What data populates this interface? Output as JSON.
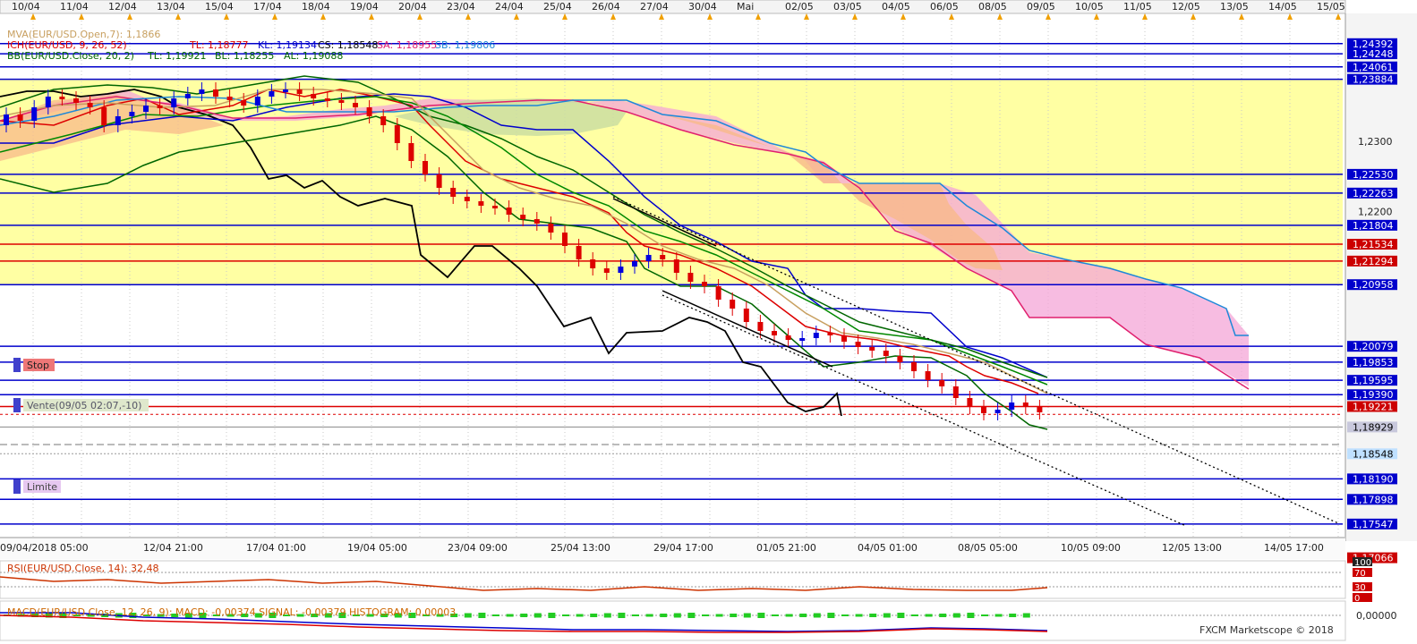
{
  "chart_data": {
    "type": "candlestick",
    "symbol": "EUR/USD",
    "top_dates": [
      "10/04",
      "11/04",
      "12/04",
      "13/04",
      "15/04",
      "17/04",
      "18/04",
      "19/04",
      "20/04",
      "23/04",
      "24/04",
      "25/04",
      "26/04",
      "27/04",
      "30/04",
      "Mai",
      "02/05",
      "03/05",
      "04/05",
      "06/05",
      "08/05",
      "09/05",
      "10/05",
      "11/05",
      "12/05",
      "13/05",
      "14/05",
      "15/05"
    ],
    "bottom_dates": [
      "09/04/2018 05:00",
      "12/04 21:00",
      "17/04 01:00",
      "19/04 05:00",
      "23/04 09:00",
      "25/04 13:00",
      "29/04 17:00",
      "01/05 21:00",
      "04/05 01:00",
      "08/05 05:00",
      "10/05 09:00",
      "12/05 13:00",
      "14/05 17:00"
    ],
    "legend": {
      "mva": "MVA(EUR/USD.Open,7): 1,1866",
      "ich": "ICH(EUR/USD, 9, 26, 52)",
      "ich_tl": "TL: 1,18777",
      "ich_kl": "KL: 1,19134",
      "ich_cs": "CS: 1,18548",
      "ich_sa": "SA: 1,18955",
      "ich_sb": "SB: 1,19806",
      "bb": "BB(EUR/USD.Close, 20, 2)",
      "bb_tl": "TL: 1,19921",
      "bb_bl": "BL: 1,18255",
      "bb_al": "AL: 1,19088"
    },
    "price_ticks": [
      "1,2300",
      "1,2200"
    ],
    "level_labels": [
      {
        "text": "1,24392",
        "kind": "blue"
      },
      {
        "text": "1,24248",
        "kind": "blue"
      },
      {
        "text": "1,24061",
        "kind": "blue"
      },
      {
        "text": "1,23884",
        "kind": "blue"
      },
      {
        "text": "1,22530",
        "kind": "blue"
      },
      {
        "text": "1,22263",
        "kind": "blue"
      },
      {
        "text": "1,21804",
        "kind": "blue"
      },
      {
        "text": "1,21534",
        "kind": "red"
      },
      {
        "text": "1,21294",
        "kind": "red"
      },
      {
        "text": "1,20958",
        "kind": "blue"
      },
      {
        "text": "1,20079",
        "kind": "blue"
      },
      {
        "text": "1,19853",
        "kind": "blue"
      },
      {
        "text": "1,19595",
        "kind": "blue"
      },
      {
        "text": "1,19390",
        "kind": "blue"
      },
      {
        "text": "1,19221",
        "kind": "red"
      },
      {
        "text": "1,18929",
        "kind": "gray"
      },
      {
        "text": "1,18548",
        "kind": "current"
      },
      {
        "text": "1,18190",
        "kind": "blue"
      },
      {
        "text": "1,17898",
        "kind": "blue"
      },
      {
        "text": "1,17547",
        "kind": "blue"
      },
      {
        "text": "1,17066",
        "kind": "red"
      }
    ],
    "orders": {
      "stop": "Stop",
      "sell": "Vente(09/05 02:07,-10)",
      "limit": "Limite"
    },
    "rsi": {
      "label": "RSI(EUR/USD.Close, 14): 32,48",
      "levels": [
        "100",
        "70",
        "30",
        "0"
      ],
      "value": 32.48
    },
    "macd": {
      "label": "MACD(EUR/USD.Close, 12, 26, 9): MACD: -0,00374 SIGNAL: -0,00379 HISTOGRAM: 0,00003",
      "zero": "0,00000"
    },
    "credit": "FXCM Marketscope © 2018"
  }
}
